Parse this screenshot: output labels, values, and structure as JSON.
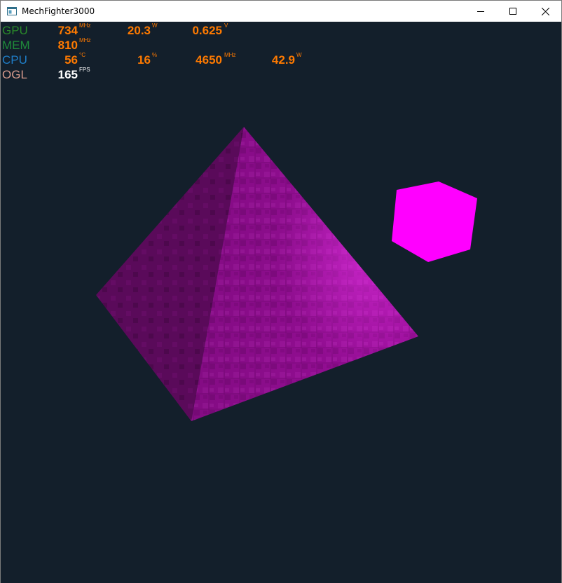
{
  "window": {
    "title": "MechFighter3000",
    "icon": "app-window-icon",
    "controls": [
      "minimize-icon",
      "maximize-icon",
      "close-icon"
    ]
  },
  "hud": {
    "gpu": {
      "label": "GPU",
      "clock": "734",
      "clock_unit": "MHz",
      "power": "20.3",
      "power_unit": "W",
      "voltage": "0.625",
      "voltage_unit": "V"
    },
    "mem": {
      "label": "MEM",
      "clock": "810",
      "clock_unit": "MHz"
    },
    "cpu": {
      "label": "CPU",
      "temp": "56",
      "temp_unit": "°C",
      "load": "16",
      "load_unit": "%",
      "clock": "4650",
      "clock_unit": "MHz",
      "power": "42.9",
      "power_unit": "W"
    },
    "ogl": {
      "label": "OGL",
      "fps": "165",
      "fps_unit": "FPS"
    }
  },
  "colors": {
    "background": "#131f2b",
    "gpu_label": "#2a8a2a",
    "mem_label": "#1f8a3a",
    "cpu_label": "#1f7ec8",
    "ogl_label": "#d79a8c",
    "value": "#ff7a00",
    "fps_value": "#ffffff",
    "pyramid": "#a010a0",
    "cube": "#ff00ff"
  }
}
